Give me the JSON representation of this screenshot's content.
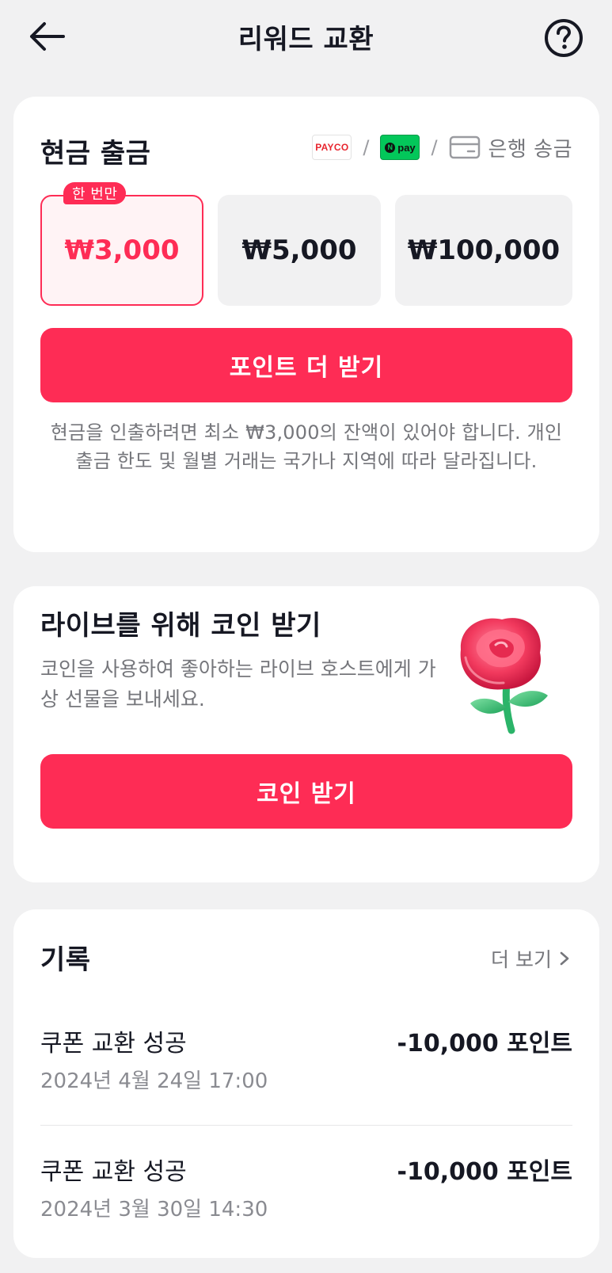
{
  "header": {
    "title": "리워드 교환"
  },
  "cash": {
    "title": "현금 출금",
    "methods": {
      "payco": "PAYCO",
      "npay": "pay",
      "bank": "은행 송금"
    },
    "badge": "한 번만",
    "amounts": [
      "₩3,000",
      "₩5,000",
      "₩100,000"
    ],
    "selected_index": 0,
    "button": "포인트 더 받기",
    "notice": "현금을 인출하려면 최소 ₩3,000의 잔액이 있어야 합니다. 개인 출금 한도 및 월별 거래는 국가나 지역에 따라 달라집니다."
  },
  "coins": {
    "title": "라이브를 위해 코인 받기",
    "description": "코인을 사용하여 좋아하는 라이브 호스트에게 가상 선물을 보내세요.",
    "button": "코인 받기"
  },
  "history": {
    "title": "기록",
    "see_more": "더 보기",
    "items": [
      {
        "title": "쿠폰 교환 성공",
        "date": "2024년 4월 24일 17:00",
        "points": "-10,000 포인트"
      },
      {
        "title": "쿠폰 교환 성공",
        "date": "2024년 3월 30일 14:30",
        "points": "-10,000 포인트"
      }
    ]
  },
  "colors": {
    "accent": "#fe2c55",
    "background": "#f1f1f2",
    "text_secondary": "#75767b"
  },
  "icons": [
    "back-arrow-icon",
    "help-circle-icon",
    "bank-card-icon",
    "chevron-right-icon",
    "rose-icon"
  ]
}
